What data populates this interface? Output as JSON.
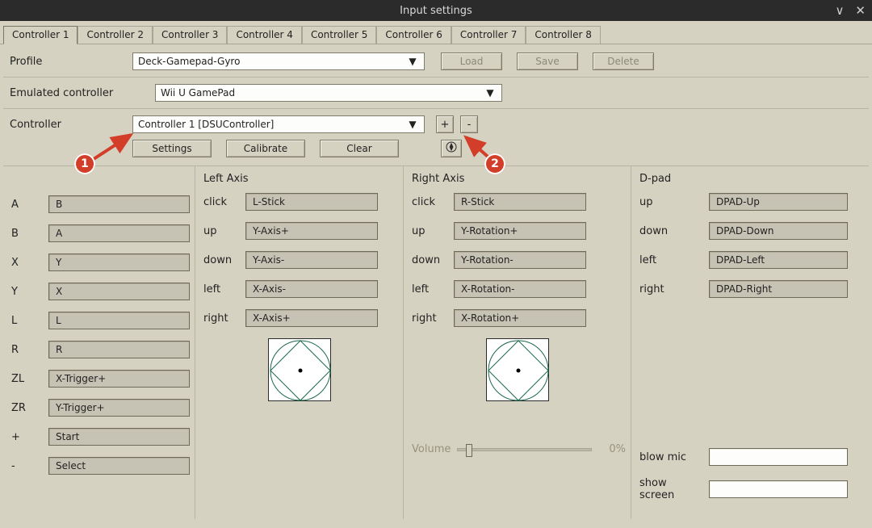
{
  "window": {
    "title": "Input settings"
  },
  "tabs": [
    "Controller 1",
    "Controller 2",
    "Controller 3",
    "Controller 4",
    "Controller 5",
    "Controller 6",
    "Controller 7",
    "Controller 8"
  ],
  "active_tab": 0,
  "profile": {
    "label": "Profile",
    "value": "Deck-Gamepad-Gyro",
    "load": "Load",
    "save": "Save",
    "delete": "Delete"
  },
  "emulated": {
    "label": "Emulated controller",
    "value": "Wii U GamePad"
  },
  "controller": {
    "label": "Controller",
    "value": "Controller 1 [DSUController]",
    "add": "+",
    "remove": "-",
    "settings": "Settings",
    "calibrate": "Calibrate",
    "clear": "Clear"
  },
  "mappings": {
    "buttons": [
      {
        "key": "A",
        "val": "B"
      },
      {
        "key": "B",
        "val": "A"
      },
      {
        "key": "X",
        "val": "Y"
      },
      {
        "key": "Y",
        "val": "X"
      },
      {
        "key": "L",
        "val": "L"
      },
      {
        "key": "R",
        "val": "R"
      },
      {
        "key": "ZL",
        "val": "X-Trigger+"
      },
      {
        "key": "ZR",
        "val": "Y-Trigger+"
      },
      {
        "key": "+",
        "val": "Start"
      },
      {
        "key": "-",
        "val": "Select"
      }
    ],
    "left_axis": {
      "header": "Left Axis",
      "rows": [
        {
          "key": "click",
          "val": "L-Stick"
        },
        {
          "key": "up",
          "val": "Y-Axis+"
        },
        {
          "key": "down",
          "val": "Y-Axis-"
        },
        {
          "key": "left",
          "val": "X-Axis-"
        },
        {
          "key": "right",
          "val": "X-Axis+"
        }
      ]
    },
    "right_axis": {
      "header": "Right Axis",
      "rows": [
        {
          "key": "click",
          "val": "R-Stick"
        },
        {
          "key": "up",
          "val": "Y-Rotation+"
        },
        {
          "key": "down",
          "val": "Y-Rotation-"
        },
        {
          "key": "left",
          "val": "X-Rotation-"
        },
        {
          "key": "right",
          "val": "X-Rotation+"
        }
      ],
      "volume_label": "Volume",
      "volume_percent": "0%"
    },
    "dpad": {
      "header": "D-pad",
      "rows": [
        {
          "key": "up",
          "val": "DPAD-Up"
        },
        {
          "key": "down",
          "val": "DPAD-Down"
        },
        {
          "key": "left",
          "val": "DPAD-Left"
        },
        {
          "key": "right",
          "val": "DPAD-Right"
        }
      ],
      "blow_mic": "blow mic",
      "show_screen": "show screen"
    }
  },
  "annotations": {
    "one": "1",
    "two": "2"
  }
}
